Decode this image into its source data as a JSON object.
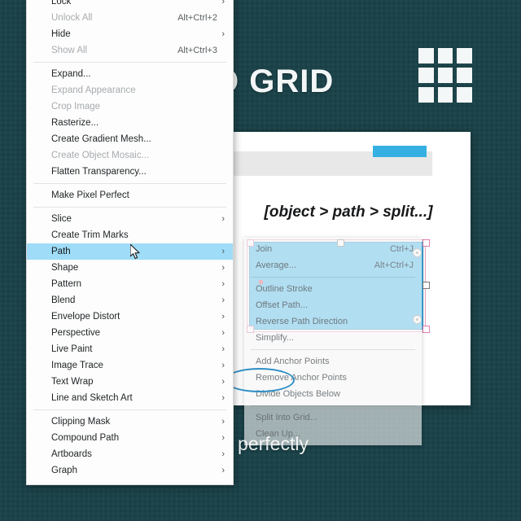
{
  "slide": {
    "title": "O GRID",
    "caption": "ting layouts with perfectly\ners.",
    "grid_icon": "grid-3x3-icon",
    "background_color": "#1b4349",
    "accent_color": "#34b0e2"
  },
  "app_card": {
    "path_hint": "[object > path > split...]",
    "toolbar_color": "#e8e8e8",
    "tab_color": "#34b0e2",
    "artwork_fill": "#45b8e9"
  },
  "context_menu": {
    "items": [
      {
        "label": "Lock",
        "shortcut": "",
        "arrow": true,
        "disabled": false,
        "selected": false
      },
      {
        "label": "Unlock All",
        "shortcut": "Alt+Ctrl+2",
        "arrow": false,
        "disabled": true,
        "selected": false
      },
      {
        "label": "Hide",
        "shortcut": "",
        "arrow": true,
        "disabled": false,
        "selected": false
      },
      {
        "label": "Show All",
        "shortcut": "Alt+Ctrl+3",
        "arrow": false,
        "disabled": true,
        "selected": false
      },
      {
        "separator": true
      },
      {
        "label": "Expand...",
        "shortcut": "",
        "arrow": false,
        "disabled": false,
        "selected": false
      },
      {
        "label": "Expand Appearance",
        "shortcut": "",
        "arrow": false,
        "disabled": true,
        "selected": false
      },
      {
        "label": "Crop Image",
        "shortcut": "",
        "arrow": false,
        "disabled": true,
        "selected": false
      },
      {
        "label": "Rasterize...",
        "shortcut": "",
        "arrow": false,
        "disabled": false,
        "selected": false
      },
      {
        "label": "Create Gradient Mesh...",
        "shortcut": "",
        "arrow": false,
        "disabled": false,
        "selected": false
      },
      {
        "label": "Create Object Mosaic...",
        "shortcut": "",
        "arrow": false,
        "disabled": true,
        "selected": false
      },
      {
        "label": "Flatten Transparency...",
        "shortcut": "",
        "arrow": false,
        "disabled": false,
        "selected": false
      },
      {
        "separator": true
      },
      {
        "label": "Make Pixel Perfect",
        "shortcut": "",
        "arrow": false,
        "disabled": false,
        "selected": false
      },
      {
        "separator": true
      },
      {
        "label": "Slice",
        "shortcut": "",
        "arrow": true,
        "disabled": false,
        "selected": false
      },
      {
        "label": "Create Trim Marks",
        "shortcut": "",
        "arrow": false,
        "disabled": false,
        "selected": false
      },
      {
        "label": "Path",
        "shortcut": "",
        "arrow": true,
        "disabled": false,
        "selected": true
      },
      {
        "label": "Shape",
        "shortcut": "",
        "arrow": true,
        "disabled": false,
        "selected": false
      },
      {
        "label": "Pattern",
        "shortcut": "",
        "arrow": true,
        "disabled": false,
        "selected": false
      },
      {
        "label": "Blend",
        "shortcut": "",
        "arrow": true,
        "disabled": false,
        "selected": false
      },
      {
        "label": "Envelope Distort",
        "shortcut": "",
        "arrow": true,
        "disabled": false,
        "selected": false
      },
      {
        "label": "Perspective",
        "shortcut": "",
        "arrow": true,
        "disabled": false,
        "selected": false
      },
      {
        "label": "Live Paint",
        "shortcut": "",
        "arrow": true,
        "disabled": false,
        "selected": false
      },
      {
        "label": "Image Trace",
        "shortcut": "",
        "arrow": true,
        "disabled": false,
        "selected": false
      },
      {
        "label": "Text Wrap",
        "shortcut": "",
        "arrow": true,
        "disabled": false,
        "selected": false
      },
      {
        "label": "Line and Sketch Art",
        "shortcut": "",
        "arrow": true,
        "disabled": false,
        "selected": false
      },
      {
        "separator": true
      },
      {
        "label": "Clipping Mask",
        "shortcut": "",
        "arrow": true,
        "disabled": false,
        "selected": false
      },
      {
        "label": "Compound Path",
        "shortcut": "",
        "arrow": true,
        "disabled": false,
        "selected": false
      },
      {
        "label": "Artboards",
        "shortcut": "",
        "arrow": true,
        "disabled": false,
        "selected": false
      },
      {
        "label": "Graph",
        "shortcut": "",
        "arrow": true,
        "disabled": false,
        "selected": false
      }
    ]
  },
  "submenu": {
    "items": [
      {
        "label": "Join",
        "shortcut": "Ctrl+J"
      },
      {
        "label": "Average...",
        "shortcut": "Alt+Ctrl+J"
      },
      {
        "separator": true
      },
      {
        "label": "Outline Stroke",
        "shortcut": ""
      },
      {
        "label": "Offset Path...",
        "shortcut": ""
      },
      {
        "label": "Reverse Path Direction",
        "shortcut": ""
      },
      {
        "label": "Simplify...",
        "shortcut": ""
      },
      {
        "separator": true
      },
      {
        "label": "Add Anchor Points",
        "shortcut": ""
      },
      {
        "label": "Remove Anchor Points",
        "shortcut": ""
      },
      {
        "label": "Divide Objects Below",
        "shortcut": ""
      },
      {
        "separator": true
      },
      {
        "label": "Split Into Grid...",
        "shortcut": ""
      },
      {
        "label": "Clean Up...",
        "shortcut": ""
      }
    ],
    "highlighted": "Divide Objects Below"
  }
}
